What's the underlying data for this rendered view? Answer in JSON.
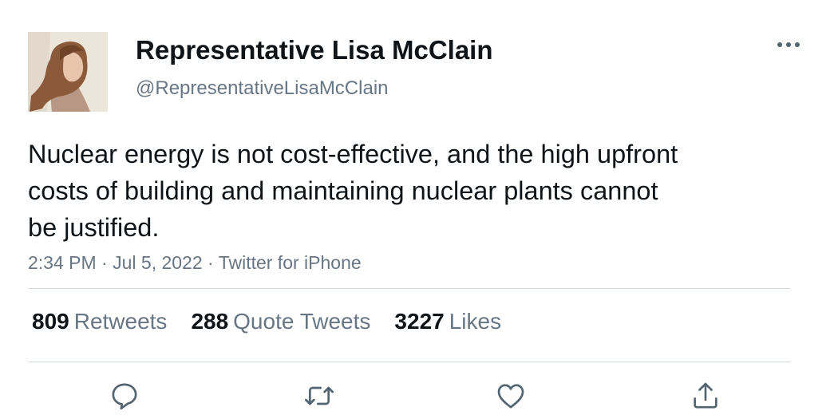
{
  "author": {
    "display_name": "Representative Lisa McClain",
    "handle": "@RepresentativeLisaMcClain"
  },
  "tweet": {
    "text": "Nuclear energy is not cost-effective, and the high upfront costs of building and maintaining nuclear plants cannot be justified.",
    "time": "2:34 PM",
    "date": "Jul 5, 2022",
    "source": "Twitter for iPhone",
    "separator": "·"
  },
  "stats": {
    "retweets": {
      "count": "809",
      "label": "Retweets"
    },
    "quotes": {
      "count": "288",
      "label": "Quote Tweets"
    },
    "likes": {
      "count": "3227",
      "label": "Likes"
    }
  },
  "icons": {
    "more": "more-horizontal-icon",
    "reply": "reply-icon",
    "retweet": "retweet-icon",
    "like": "heart-icon",
    "share": "share-icon"
  },
  "colors": {
    "text_primary": "#0f1419",
    "text_secondary": "#687684",
    "divider": "#cfd9de",
    "icon": "#536471"
  }
}
